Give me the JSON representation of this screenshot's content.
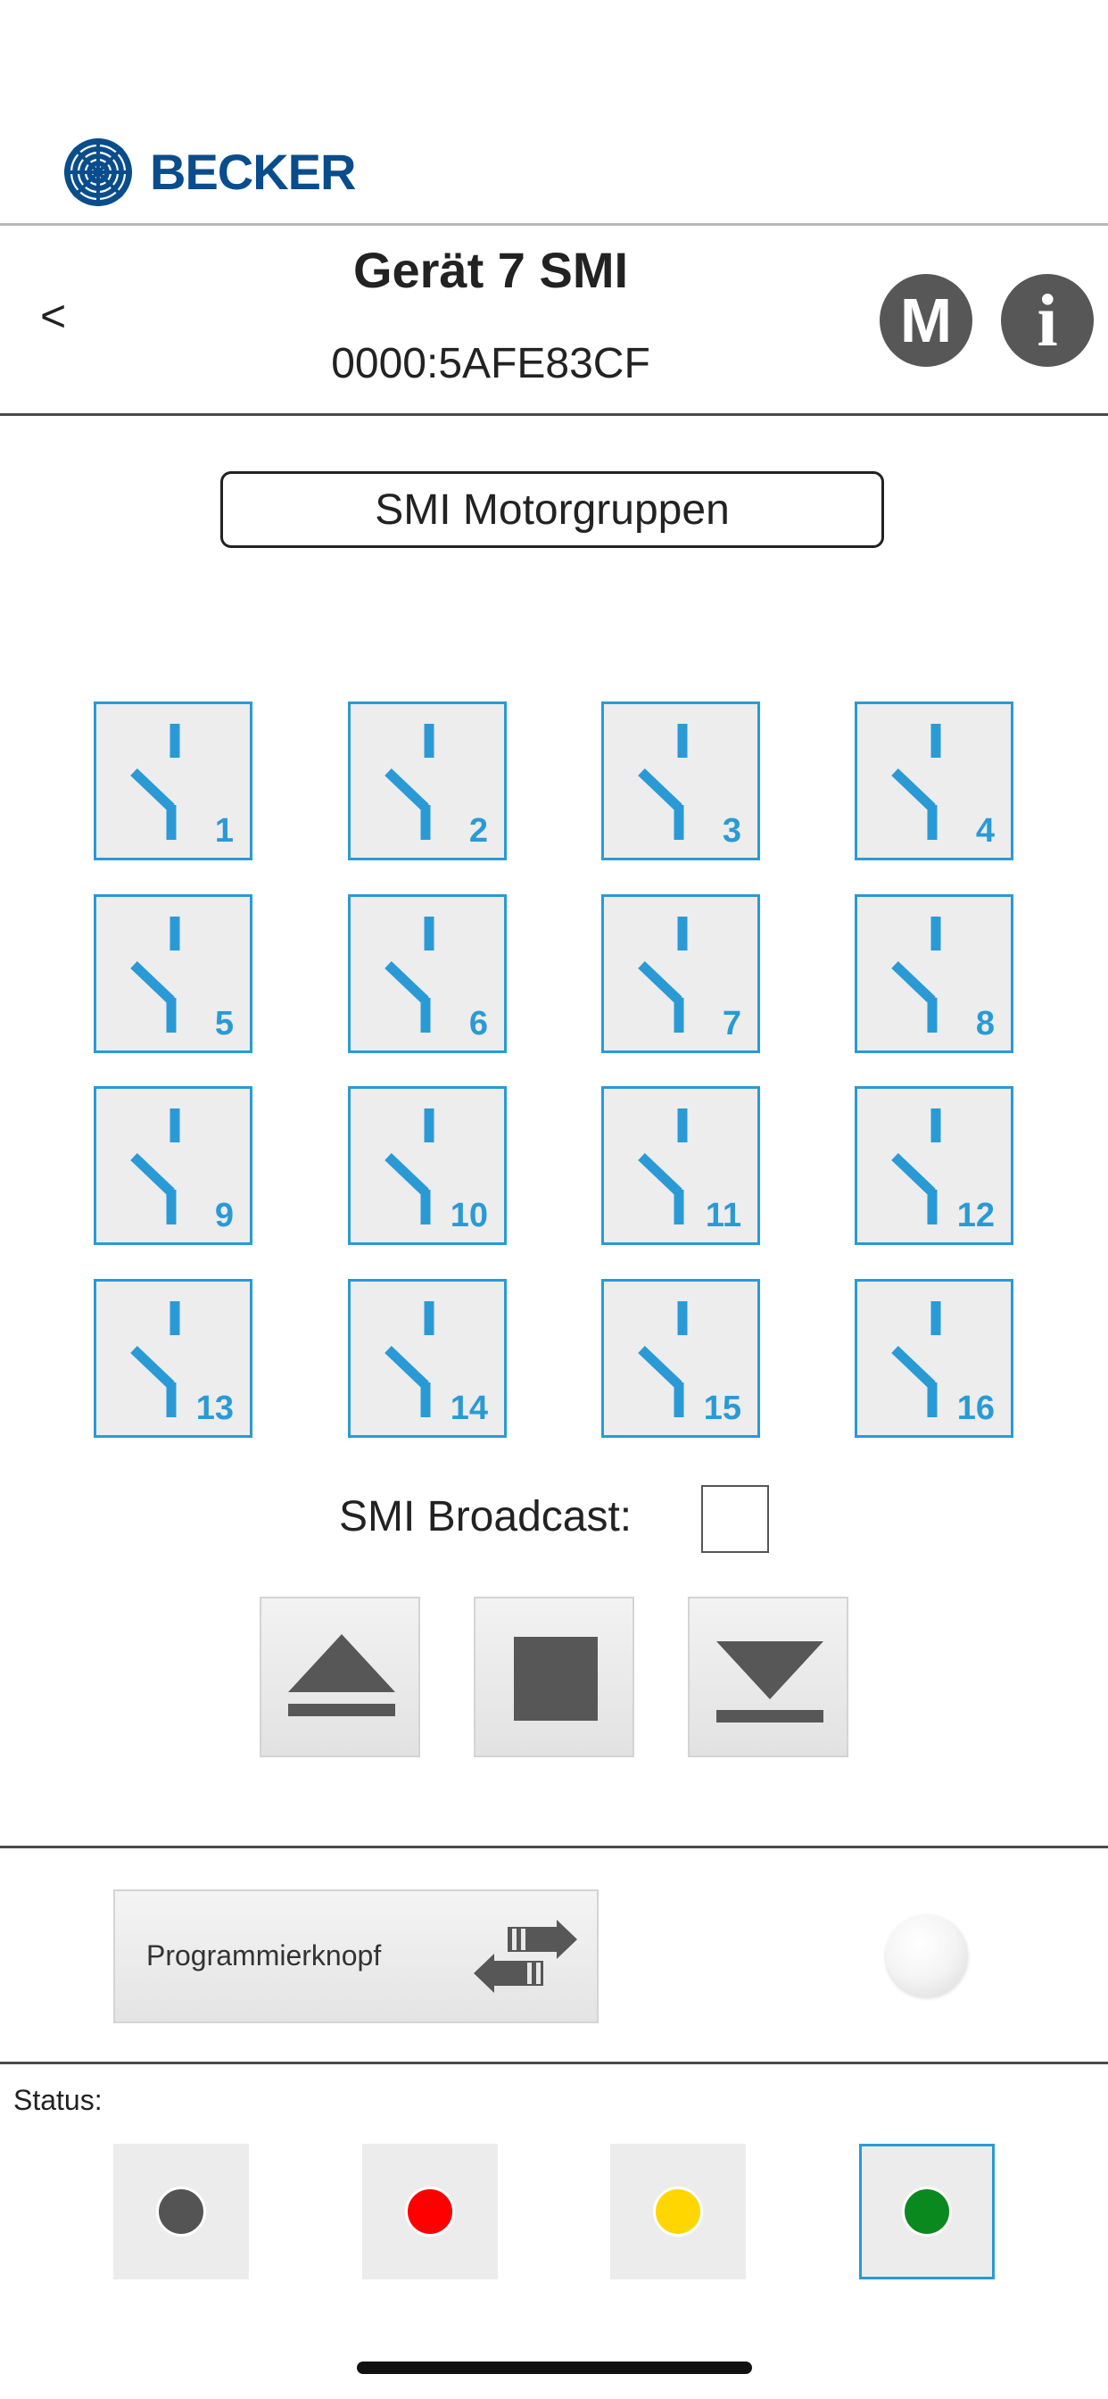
{
  "brand": {
    "name": "BECKER",
    "color": "#0a4d8c"
  },
  "header": {
    "back_label": "<",
    "title": "Gerät 7 SMI",
    "device_id": "0000:5AFE83CF",
    "menu_button_label": "M",
    "info_button_label": "i"
  },
  "group_button_label": "SMI Motorgruppen",
  "channels": [
    "1",
    "2",
    "3",
    "4",
    "5",
    "6",
    "7",
    "8",
    "9",
    "10",
    "11",
    "12",
    "13",
    "14",
    "15",
    "16"
  ],
  "broadcast": {
    "label": "SMI Broadcast:",
    "checked": false
  },
  "controls": {
    "up_icon": "up-arrow-icon",
    "stop_icon": "stop-icon",
    "down_icon": "down-arrow-icon"
  },
  "programming": {
    "label": "Programmierknopf",
    "icon": "swap-arrows-icon"
  },
  "status": {
    "label": "Status:",
    "options": [
      {
        "color": "#545454",
        "selected": false
      },
      {
        "color": "#ff0000",
        "selected": false
      },
      {
        "color": "#ffd600",
        "selected": false
      },
      {
        "color": "#0a8a1e",
        "selected": true
      }
    ]
  },
  "colors": {
    "accent": "#2a9ad6",
    "button_dark": "#575757"
  }
}
